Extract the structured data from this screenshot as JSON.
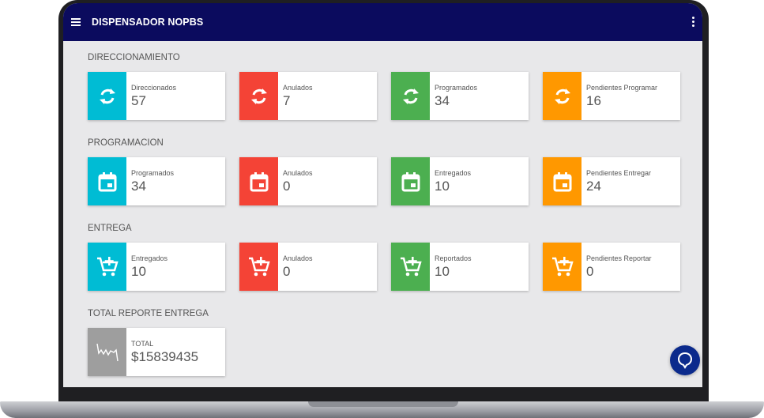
{
  "app": {
    "title": "DISPENSADOR NOPBS"
  },
  "colors": {
    "cyan": "#00bcd4",
    "red": "#f44336",
    "green": "#4caf50",
    "orange": "#ff9800",
    "gray": "#9e9e9e",
    "appbar": "#0b0b5e"
  },
  "sections": [
    {
      "title": "DIRECCIONAMIENTO",
      "icon": "refresh-icon",
      "cards": [
        {
          "label": "Direccionados",
          "value": "57",
          "color": "cyan"
        },
        {
          "label": "Anulados",
          "value": "7",
          "color": "red"
        },
        {
          "label": "Programados",
          "value": "34",
          "color": "green"
        },
        {
          "label": "Pendientes Programar",
          "value": "16",
          "color": "orange"
        }
      ]
    },
    {
      "title": "PROGRAMACION",
      "icon": "calendar-icon",
      "cards": [
        {
          "label": "Programados",
          "value": "34",
          "color": "cyan"
        },
        {
          "label": "Anulados",
          "value": "0",
          "color": "red"
        },
        {
          "label": "Entregados",
          "value": "10",
          "color": "green"
        },
        {
          "label": "Pendientes Entregar",
          "value": "24",
          "color": "orange"
        }
      ]
    },
    {
      "title": "ENTREGA",
      "icon": "add-cart-icon",
      "cards": [
        {
          "label": "Entregados",
          "value": "10",
          "color": "cyan"
        },
        {
          "label": "Anulados",
          "value": "0",
          "color": "red"
        },
        {
          "label": "Reportados",
          "value": "10",
          "color": "green"
        },
        {
          "label": "Pendientes Reportar",
          "value": "0",
          "color": "orange"
        }
      ]
    },
    {
      "title": "TOTAL REPORTE ENTREGA",
      "icon": "trend-chart-icon",
      "cards": [
        {
          "label": "TOTAL",
          "value": "$15839435",
          "color": "gray"
        }
      ]
    }
  ]
}
